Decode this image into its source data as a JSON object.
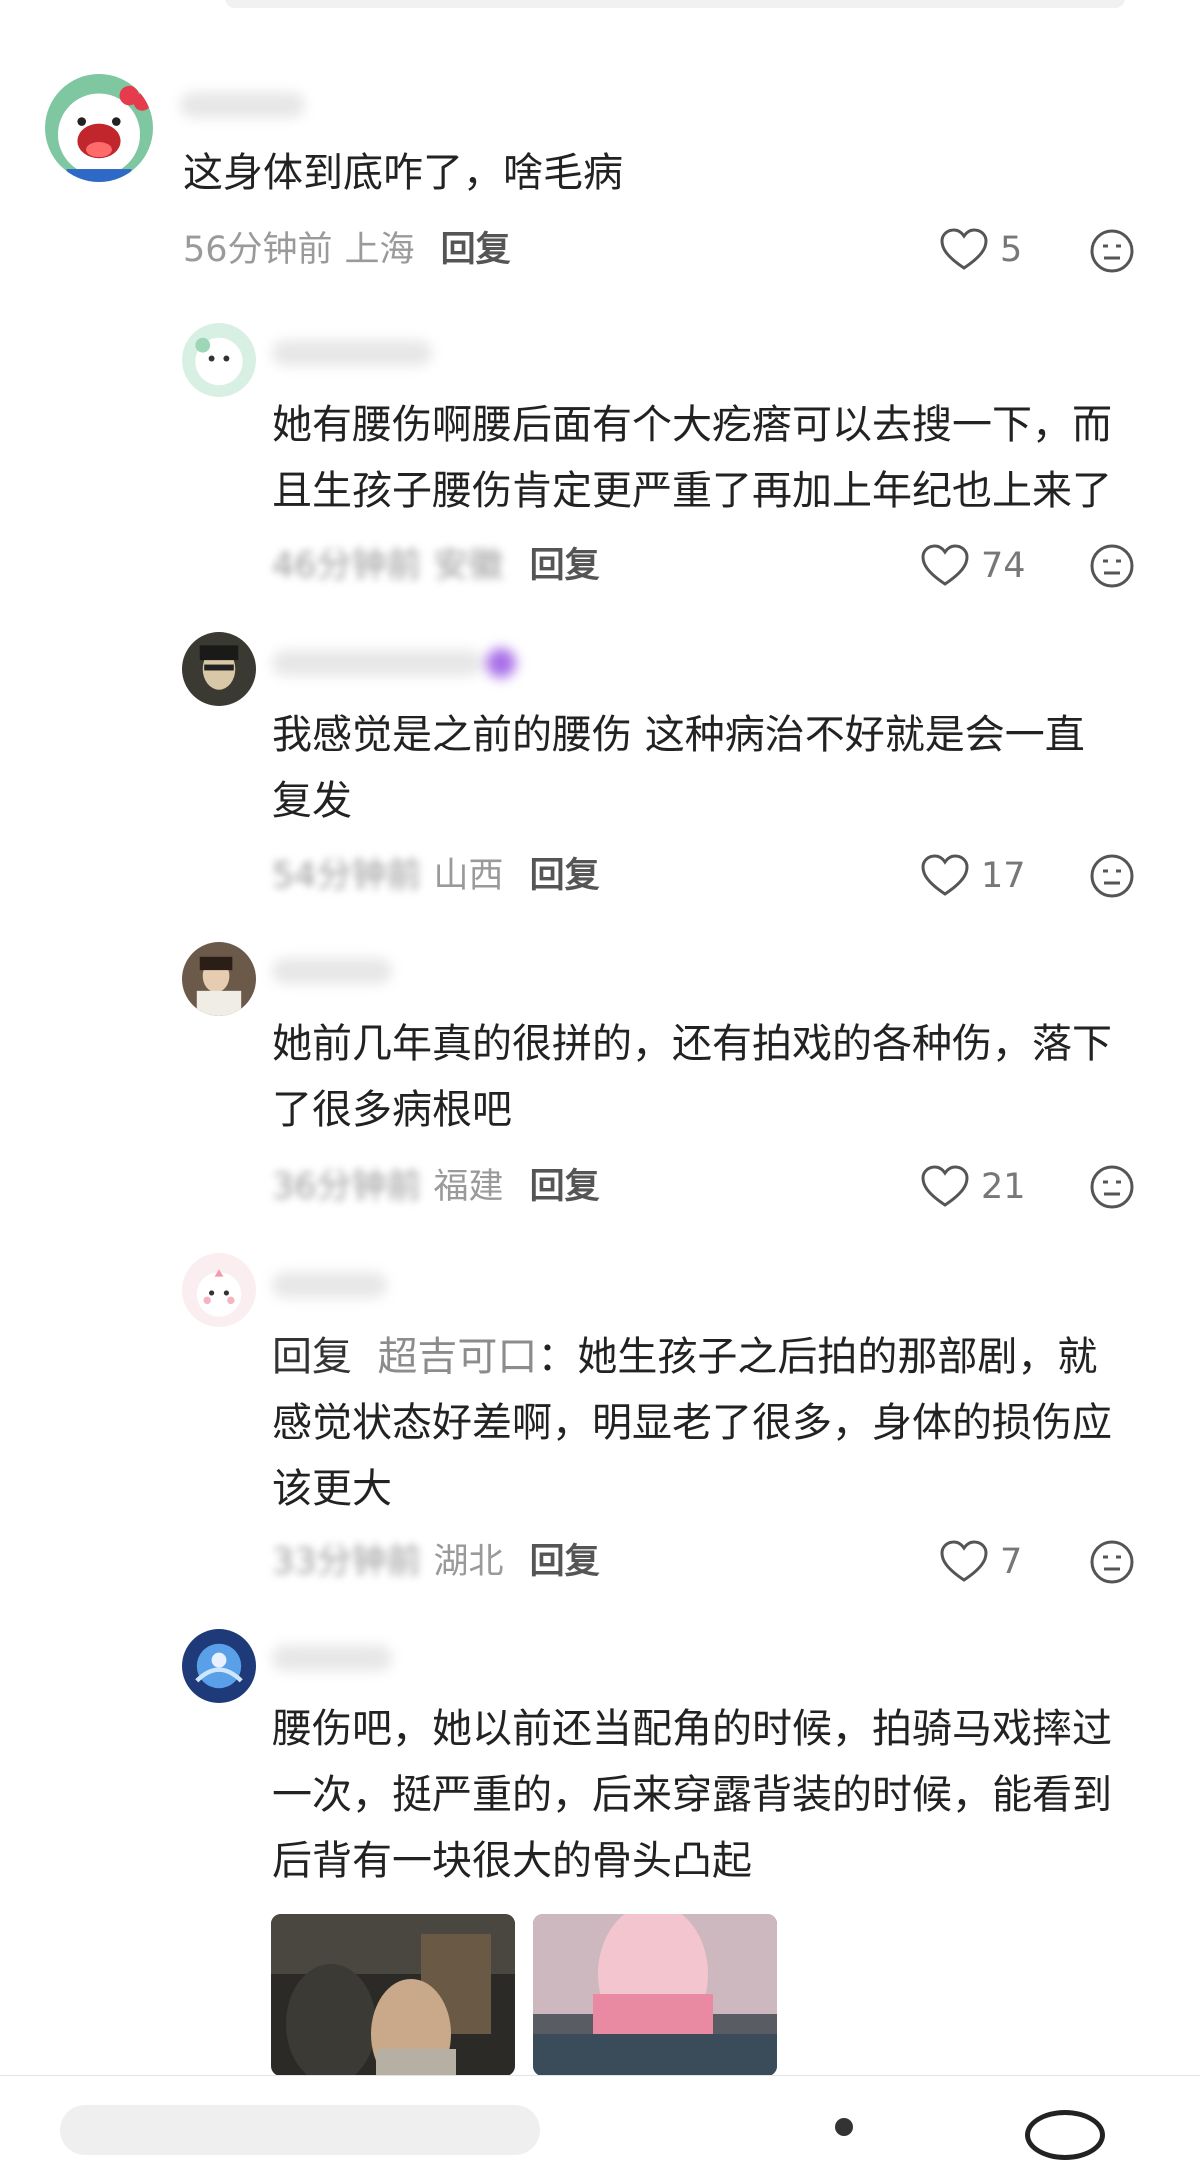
{
  "comments": [
    {
      "text_parts": [
        "这身体到底咋了，啥毛病"
      ],
      "time": "56分钟前",
      "location": "上海",
      "reply_label": "回复",
      "likes": "5"
    },
    {
      "text_parts": [
        "她有腰伤啊腰后面有个大疙瘩可以去搜一下，而",
        "且生孩子腰伤肯定更严重了再加上年纪也上来了"
      ],
      "time": "46分钟前",
      "location": "安徽",
      "reply_label": "回复",
      "likes": "74"
    },
    {
      "text_parts": [
        "我感觉是之前的腰伤 这种病治不好就是会一直",
        "复发"
      ],
      "time": "54分钟前",
      "location": "山西",
      "reply_label": "回复",
      "likes": "17"
    },
    {
      "text_parts": [
        "她前几年真的很拼的，还有拍戏的各种伤，落下",
        "了很多病根吧"
      ],
      "time": "36分钟前",
      "location": "福建",
      "reply_label": "回复",
      "likes": "21"
    },
    {
      "reply_prefix": "回复",
      "mention": "超吉可口",
      "text_parts": [
        "：她生孩子之后拍的那部剧，就",
        "感觉状态好差啊，明显老了很多，身体的损伤应",
        "该更大"
      ],
      "time": "33分钟前",
      "location": "湖北",
      "reply_label": "回复",
      "likes": "7"
    },
    {
      "text_parts": [
        "腰伤吧，她以前还当配角的时候，拍骑马戏摔过",
        "一次，挺严重的，后来穿露背装的时候，能看到",
        "后背有一块很大的骨头凸起"
      ]
    }
  ],
  "icons": {
    "like": "heart-outline-icon",
    "dislike": "neutral-face-icon"
  },
  "colors": {
    "text": "#222222",
    "meta": "#9a9a9a",
    "mention": "#8c8c8c"
  }
}
